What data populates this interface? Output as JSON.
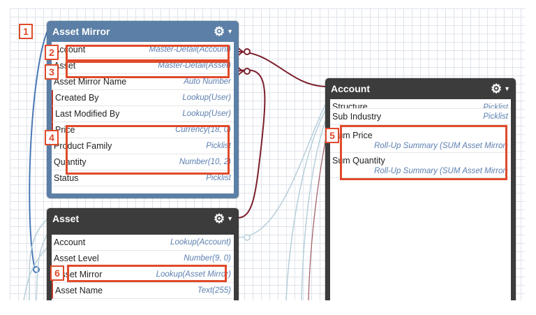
{
  "colors": {
    "asset_mirror_header": "#5b7fa6",
    "object_header_dark": "#3c3c3c",
    "highlight": "#e04a2b",
    "master_detail_line": "#7a1f2b",
    "lookup_line": "#9fc0cf",
    "field_type_text": "#5b7fb0"
  },
  "asset_mirror": {
    "title": "Asset Mirror",
    "menu_icon": "gear-icon",
    "fields": [
      {
        "name": "Account",
        "type": "Master-Detail(Account)"
      },
      {
        "name": "Asset",
        "type": "Master-Detail(Asset)"
      },
      {
        "name": "Asset Mirror Name",
        "type": "Auto Number"
      },
      {
        "name": "Created By",
        "type": "Lookup(User)"
      },
      {
        "name": "Last Modified By",
        "type": "Lookup(User)"
      },
      {
        "name": "Price",
        "type": "Currency(18, 0)"
      },
      {
        "name": "Product Family",
        "type": "Picklist"
      },
      {
        "name": "Quantity",
        "type": "Number(10, 2)"
      },
      {
        "name": "Status",
        "type": "Picklist"
      }
    ]
  },
  "asset": {
    "title": "Asset",
    "menu_icon": "gear-icon",
    "fields": [
      {
        "name": "Account",
        "type": "Lookup(Account)"
      },
      {
        "name": "Asset Level",
        "type": "Number(9, 0)"
      },
      {
        "name": "Asset Mirror",
        "type": "Lookup(Asset Mirror)"
      },
      {
        "name": "Asset Name",
        "type": "Text(255)"
      }
    ]
  },
  "account": {
    "title": "Account",
    "menu_icon": "gear-icon",
    "fields": [
      {
        "name": "Structure",
        "type": "Picklist"
      },
      {
        "name": "Sub Industry",
        "type": "Picklist"
      },
      {
        "name": "Sum Price",
        "type": "Roll-Up Summary (SUM Asset Mirror)"
      },
      {
        "name": "Sum Quantity",
        "type": "Roll-Up Summary (SUM Asset Mirror)"
      }
    ]
  },
  "callouts": [
    "1",
    "2",
    "3",
    "4",
    "5",
    "6"
  ]
}
